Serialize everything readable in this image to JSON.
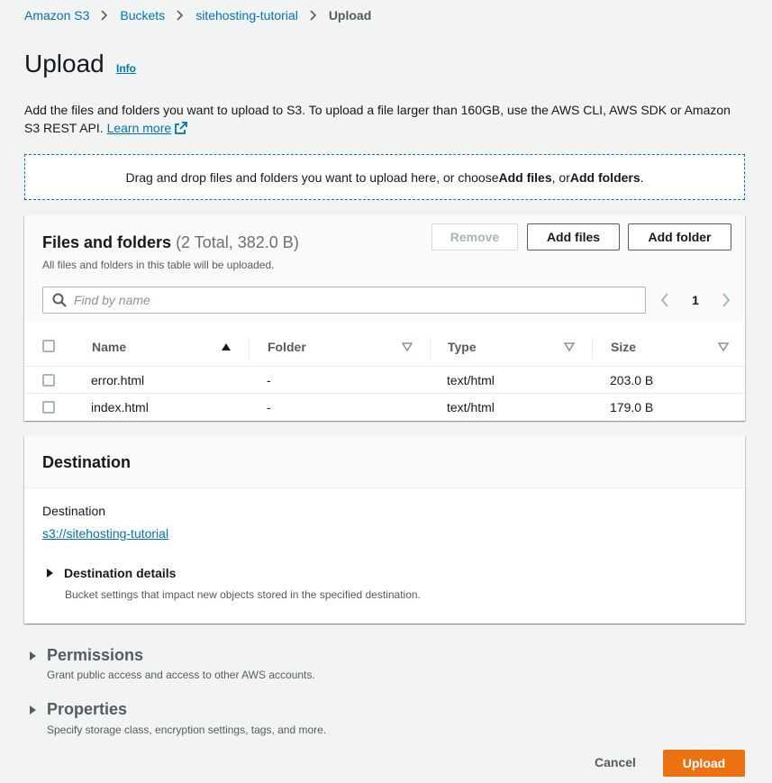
{
  "breadcrumb": {
    "items": [
      "Amazon S3",
      "Buckets",
      "sitehosting-tutorial"
    ],
    "current": "Upload"
  },
  "page": {
    "title": "Upload",
    "info": "Info",
    "description": "Add the files and folders you want to upload to S3. To upload a file larger than 160GB, use the AWS CLI, AWS SDK or Amazon S3 REST API.",
    "learn_more": "Learn more"
  },
  "dropzone": {
    "text_before": "Drag and drop files and folders you want to upload here, or choose ",
    "add_files": "Add files",
    "mid": ", or ",
    "add_folders": "Add folders",
    "end": "."
  },
  "files": {
    "title": "Files and folders",
    "count": "(2 Total, 382.0 B)",
    "subtitle": "All files and folders in this table will be uploaded.",
    "remove_label": "Remove",
    "add_files_label": "Add files",
    "add_folder_label": "Add folder",
    "search_placeholder": "Find by name",
    "page": "1",
    "columns": [
      "Name",
      "Folder",
      "Type",
      "Size"
    ],
    "rows": [
      {
        "name": "error.html",
        "folder": "-",
        "type": "text/html",
        "size": "203.0 B"
      },
      {
        "name": "index.html",
        "folder": "-",
        "type": "text/html",
        "size": "179.0 B"
      }
    ]
  },
  "destination": {
    "title": "Destination",
    "label": "Destination",
    "link": "s3://sitehosting-tutorial",
    "details_title": "Destination details",
    "details_sub": "Bucket settings that impact new objects stored in the specified destination."
  },
  "permissions": {
    "title": "Permissions",
    "sub": "Grant public access and access to other AWS accounts."
  },
  "properties": {
    "title": "Properties",
    "sub": "Specify storage class, encryption settings, tags, and more."
  },
  "actions": {
    "cancel": "Cancel",
    "upload": "Upload"
  },
  "colors": {
    "link": "#0073bb",
    "primary": "#ec7211"
  }
}
